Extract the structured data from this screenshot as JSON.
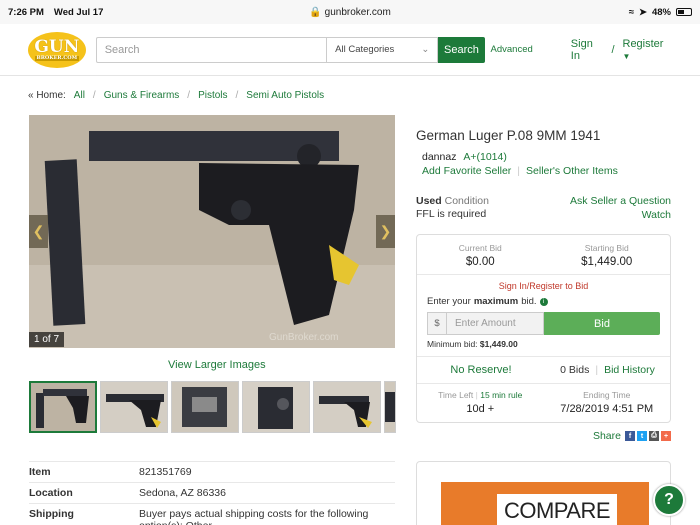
{
  "status_bar": {
    "time": "7:26 PM",
    "date": "Wed Jul 17",
    "url": "gunbroker.com",
    "battery": "48%"
  },
  "header": {
    "logo_top": "GUN",
    "logo_bottom": "BROKER.COM",
    "search_placeholder": "Search",
    "category": "All Categories",
    "search_button": "Search",
    "advanced": "Advanced",
    "sign_in": "Sign In",
    "divider": "/",
    "register": "Register"
  },
  "breadcrumb": {
    "home": "« Home:",
    "items": [
      "All",
      "Guns & Firearms",
      "Pistols",
      "Semi Auto Pistols"
    ]
  },
  "gallery": {
    "counter": "1 of 7",
    "view_larger": "View Larger Images",
    "watermark": "GunBroker.com"
  },
  "item": {
    "title": "German Luger P.08 9MM 1941",
    "seller_name": "dannaz",
    "seller_rating": "A+(1014)",
    "add_favorite": "Add Favorite Seller",
    "other_items": "Seller's Other Items",
    "condition_value": "Used",
    "condition_label": "Condition",
    "ffl": "FFL is required",
    "ask_seller": "Ask Seller a Question",
    "watch": "Watch"
  },
  "bid_box": {
    "current_bid_label": "Current Bid",
    "current_bid": "$0.00",
    "starting_bid_label": "Starting Bid",
    "starting_bid": "$1,449.00",
    "sign_in_register": "Sign In/Register to Bid",
    "enter_prefix": "Enter your",
    "enter_bold": "maximum",
    "enter_suffix": "bid.",
    "dollar": "$",
    "amount_placeholder": "Enter Amount",
    "bid_button": "Bid",
    "min_bid_label": "Minimum bid:",
    "min_bid": "$1,449.00",
    "no_reserve": "No Reserve!",
    "bids": "0 Bids",
    "bid_history": "Bid History",
    "time_left_label": "Time Left",
    "rule_link": "15 min rule",
    "time_left": "10d +",
    "ending_label": "Ending Time",
    "ending_time": "7/28/2019 4:51 PM"
  },
  "share": {
    "label": "Share"
  },
  "details": [
    {
      "key": "Item",
      "value": "821351769"
    },
    {
      "key": "Location",
      "value": "Sedona, AZ 86336"
    },
    {
      "key": "Shipping",
      "value": "Buyer pays actual shipping costs for the following option(s): Other"
    }
  ],
  "promo": {
    "text": "COMPARE"
  },
  "help": {
    "label": "?"
  }
}
